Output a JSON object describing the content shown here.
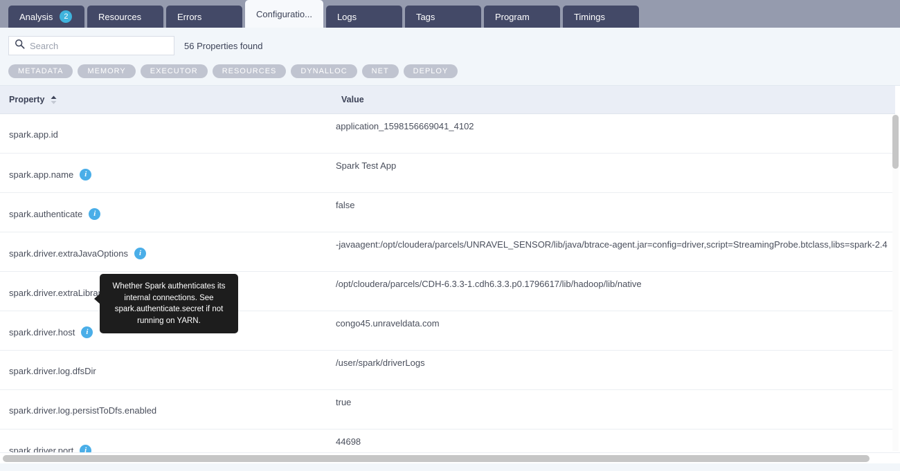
{
  "tabs": [
    {
      "label": "Analysis",
      "badge": "2",
      "active": false
    },
    {
      "label": "Resources",
      "badge": null,
      "active": false
    },
    {
      "label": "Errors",
      "badge": null,
      "active": false
    },
    {
      "label": "Configuratio...",
      "badge": null,
      "active": true
    },
    {
      "label": "Logs",
      "badge": null,
      "active": false
    },
    {
      "label": "Tags",
      "badge": null,
      "active": false
    },
    {
      "label": "Program",
      "badge": null,
      "active": false
    },
    {
      "label": "Timings",
      "badge": null,
      "active": false
    }
  ],
  "toolbar": {
    "search_placeholder": "Search",
    "search_value": "",
    "search_icon": "search-icon",
    "results_text": "56 Properties found",
    "chips": [
      "METADATA",
      "MEMORY",
      "EXECUTOR",
      "RESOURCES",
      "DYNALLOC",
      "NET",
      "DEPLOY"
    ]
  },
  "table": {
    "columns": [
      {
        "label": "Property",
        "sorted": "asc"
      },
      {
        "label": "Value",
        "sorted": null
      }
    ],
    "rows": [
      {
        "property": "spark.app.id",
        "info": false,
        "value": "application_1598156669041_4102"
      },
      {
        "property": "spark.app.name",
        "info": true,
        "value": "Spark Test App"
      },
      {
        "property": "spark.authenticate",
        "info": true,
        "value": "false"
      },
      {
        "property": "spark.driver.extraJavaOptions",
        "info": true,
        "value": "-javaagent:/opt/cloudera/parcels/UNRAVEL_SENSOR/lib/java/btrace-agent.jar=config=driver,script=StreamingProbe.btclass,libs=spark-2.4"
      },
      {
        "property": "spark.driver.extraLibraryPath",
        "info": true,
        "value": "/opt/cloudera/parcels/CDH-6.3.3-1.cdh6.3.3.p0.1796617/lib/hadoop/lib/native"
      },
      {
        "property": "spark.driver.host",
        "info": true,
        "value": "congo45.unraveldata.com"
      },
      {
        "property": "spark.driver.log.dfsDir",
        "info": false,
        "value": "/user/spark/driverLogs"
      },
      {
        "property": "spark.driver.log.persistToDfs.enabled",
        "info": false,
        "value": "true"
      },
      {
        "property": "spark.driver.port",
        "info": true,
        "value": "44698"
      }
    ]
  },
  "tooltip": {
    "text": "Whether Spark authenticates its internal connections. See spark.authenticate.secret if not running on YARN."
  },
  "colors": {
    "tabbar_bg": "#959bae",
    "tab_bg": "#434967",
    "tab_active_bg": "#f7f9fc",
    "badge": "#3fb3dd",
    "info_icon": "#4aaee8",
    "chip": "#c0c4d0",
    "tooltip_bg": "#1d1d1d",
    "header_bg": "#eaeef6"
  }
}
